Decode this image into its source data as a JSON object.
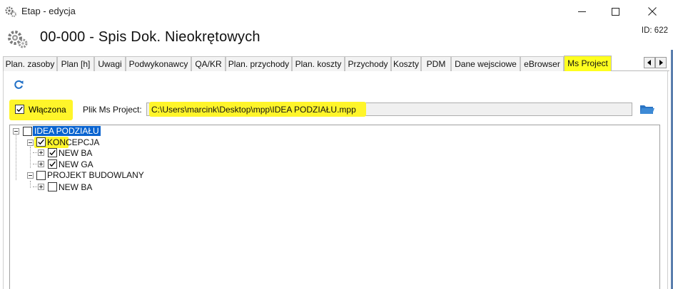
{
  "window": {
    "title": "Etap - edycja",
    "app_icon": "gears-icon",
    "controls": [
      "minimize-icon",
      "maximize-icon",
      "close-icon"
    ]
  },
  "header": {
    "title": "00-000 - Spis Dok. Nieokrętowych",
    "id_label": "ID: 622",
    "icon": "gears-icon"
  },
  "tabs": [
    {
      "label": "Plan. zasoby",
      "active": false
    },
    {
      "label": "Plan [h]",
      "active": false
    },
    {
      "label": "Uwagi",
      "active": false
    },
    {
      "label": "Podwykonawcy",
      "active": false
    },
    {
      "label": "QA/KR",
      "active": false
    },
    {
      "label": "Plan. przychody",
      "active": false
    },
    {
      "label": "Plan. koszty",
      "active": false
    },
    {
      "label": "Przychody",
      "active": false
    },
    {
      "label": "Koszty",
      "active": false
    },
    {
      "label": "PDM",
      "active": false
    },
    {
      "label": "Dane wejsciowe",
      "active": false
    },
    {
      "label": "eBrowser",
      "active": false
    },
    {
      "label": "Ms Project",
      "active": true
    }
  ],
  "tab_scroll": {
    "left": "tab-scroll-left-icon",
    "right": "tab-scroll-right-icon"
  },
  "ms_project": {
    "refresh_icon": "refresh-icon",
    "enabled_label": "Włączona",
    "enabled_checked": true,
    "file_label": "Plik Ms Project:",
    "file_path": "C:\\Users\\marcink\\Desktop\\mpp\\IDEA PODZIAŁU.mpp",
    "browse_icon": "folder-icon",
    "highlight_color": "#fff52a",
    "selection_color": "#0a64d0"
  },
  "tree": {
    "root": {
      "label": "IDEA PODZIAŁU",
      "checked": false,
      "selected": true
    },
    "groups": [
      {
        "label": "KONCEPCJA",
        "checked": true,
        "children": [
          {
            "label": "NEW BA",
            "checked": true
          },
          {
            "label": "NEW GA",
            "checked": true
          }
        ]
      },
      {
        "label": "PROJEKT BUDOWLANY",
        "checked": false,
        "children": [
          {
            "label": "NEW BA",
            "checked": false
          }
        ]
      }
    ]
  }
}
